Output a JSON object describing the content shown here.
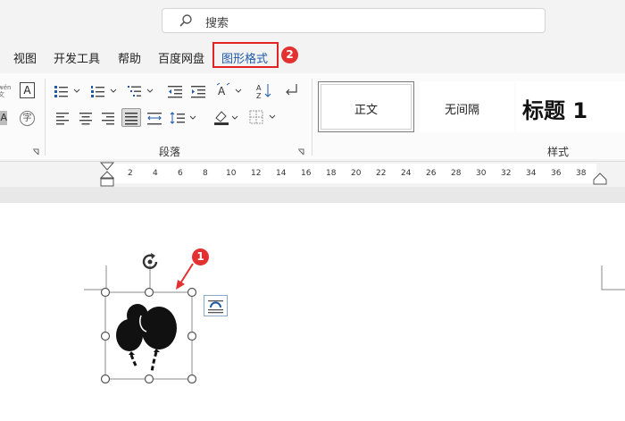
{
  "search": {
    "placeholder": "搜索"
  },
  "tabs": [
    {
      "label": "视图"
    },
    {
      "label": "开发工具"
    },
    {
      "label": "帮助"
    },
    {
      "label": "百度网盘"
    },
    {
      "label": "图形格式"
    }
  ],
  "badges": {
    "tab": "2",
    "shape": "1"
  },
  "ribbon": {
    "paragraph_label": "段落",
    "styles_label": "样式",
    "styles": [
      {
        "label": "正文"
      },
      {
        "label": "无间隔"
      },
      {
        "label": "标题 1"
      }
    ],
    "font_glyphs": {
      "char_border": "A",
      "enclose": "字"
    }
  },
  "ruler": {
    "ticks": [
      "2",
      "4",
      "6",
      "8",
      "10",
      "12",
      "14",
      "16",
      "18",
      "20",
      "22",
      "24",
      "26",
      "28",
      "30",
      "32",
      "34",
      "36",
      "38"
    ]
  },
  "shape": {
    "icon": "balloons-icon"
  },
  "colors": {
    "accent": "#1f5aa8",
    "highlight": "#e02424",
    "badge": "#e33131"
  }
}
